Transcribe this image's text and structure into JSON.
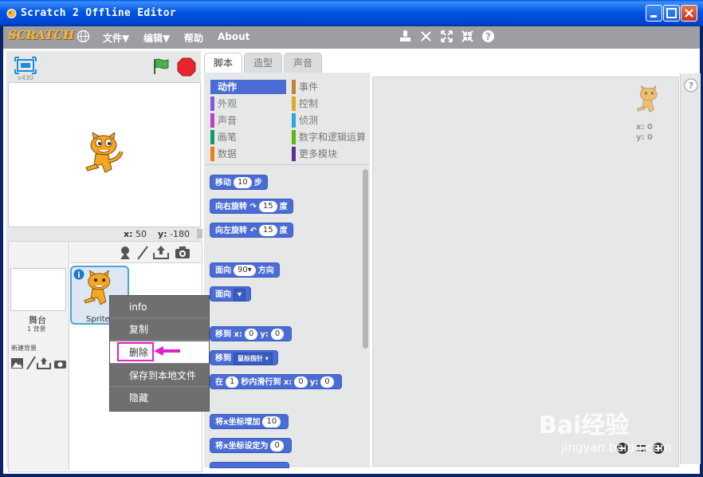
{
  "window": {
    "title": "Scratch 2 Offline Editor"
  },
  "menubar": {
    "logo": "SCRATCH",
    "file": "文件▼",
    "edit": "编辑▼",
    "help": "帮助",
    "about": "About"
  },
  "stage": {
    "version": "v430",
    "x_label": "x:",
    "x_value": "50",
    "y_label": "y:",
    "y_value": "-180"
  },
  "sprites": {
    "stage_label": "舞台",
    "stage_count": "1 背景",
    "new_backdrop": "新建背景",
    "sprite_name": "Sprite1"
  },
  "tabs": [
    "脚本",
    "造型",
    "声音"
  ],
  "categories": [
    {
      "label": "动作",
      "color": "#4A6CD4"
    },
    {
      "label": "事件",
      "color": "#C88330"
    },
    {
      "label": "外观",
      "color": "#8A55D7"
    },
    {
      "label": "控制",
      "color": "#E1A91A"
    },
    {
      "label": "声音",
      "color": "#BB42C3"
    },
    {
      "label": "侦测",
      "color": "#2CA5E2"
    },
    {
      "label": "画笔",
      "color": "#0E9A6C"
    },
    {
      "label": "数字和逻辑运算",
      "color": "#5CB712"
    },
    {
      "label": "数据",
      "color": "#EE7D16"
    },
    {
      "label": "更多模块",
      "color": "#632D99"
    }
  ],
  "blocks": {
    "move": {
      "pre": "移动",
      "val": "10",
      "post": "步"
    },
    "turn_right": {
      "pre": "向右旋转",
      "val": "15",
      "post": "度"
    },
    "turn_left": {
      "pre": "向左旋转",
      "val": "15",
      "post": "度"
    },
    "point_dir": {
      "pre": "面向",
      "val": "90▾",
      "post": "方向"
    },
    "point_towards": {
      "pre": "面向",
      "val": "▾"
    },
    "goto_xy": {
      "pre": "移到 x:",
      "x": "0",
      "mid": "y:",
      "y": "0"
    },
    "goto": {
      "pre": "移到",
      "val": "鼠标指针 ▾"
    },
    "glide": {
      "pre": "在",
      "val": "1",
      "mid": "秒内滑行到 x:",
      "x": "0",
      "mid2": "y:",
      "y": "0"
    },
    "change_x": {
      "pre": "将x坐标增加",
      "val": "10"
    },
    "set_x": {
      "pre": "将x坐标设定为",
      "val": "0"
    }
  },
  "script_area": {
    "x_label": "x: 0",
    "y_label": "y: 0"
  },
  "context_menu": [
    "info",
    "复制",
    "删除",
    "保存到本地文件",
    "隐藏"
  ],
  "watermark": {
    "main": "Bai经验",
    "sub": "jingyan.baidu.com"
  }
}
